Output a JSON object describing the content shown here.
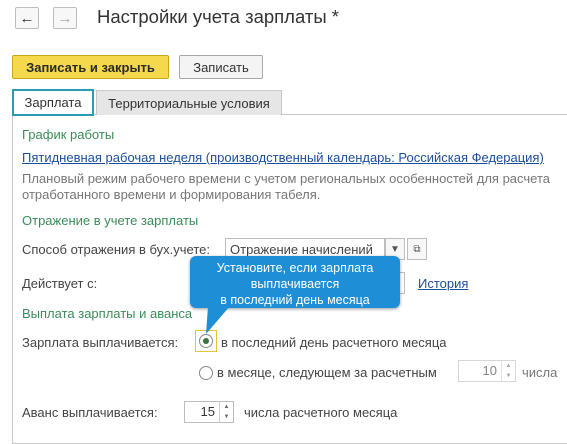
{
  "header": {
    "back_icon": "arrow-left-icon",
    "forward_icon": "arrow-right-icon",
    "title": "Настройки учета зарплаты *"
  },
  "toolbar": {
    "save_close_label": "Записать и закрыть",
    "save_label": "Записать"
  },
  "tabs": [
    {
      "label": "Зарплата",
      "active": true
    },
    {
      "label": "Территориальные условия",
      "active": false
    }
  ],
  "schedule": {
    "section_title": "График работы",
    "link_text": "Пятидневная рабочая неделя (производственный календарь: Российская Федерация)",
    "description_line1": "Плановый режим рабочего времени с учетом региональных особенностей для расчета",
    "description_line2": "отработанного времени и формирования табеля."
  },
  "accounting": {
    "section_title": "Отражение в учете зарплаты",
    "method_label": "Способ отражения в бух.учете:",
    "method_value": "Отражение начислений",
    "effective_label": "Действует с:",
    "history_link": "История"
  },
  "payment": {
    "section_title": "Выплата зарплаты и аванса",
    "salary_label": "Зарплата выплачивается:",
    "option_last_day": "в последний день расчетного месяца",
    "option_next_month": "в месяце, следующем за расчетным",
    "day_value": "10",
    "day_unit": "числа",
    "advance_label": "Аванс выплачивается:",
    "advance_value": "15",
    "advance_unit": "числа расчетного месяца"
  },
  "callout": {
    "line1": "Установите, если зарплата",
    "line2": "выплачивается",
    "line3": "в последний день месяца",
    "color": "#1e8fd6"
  }
}
